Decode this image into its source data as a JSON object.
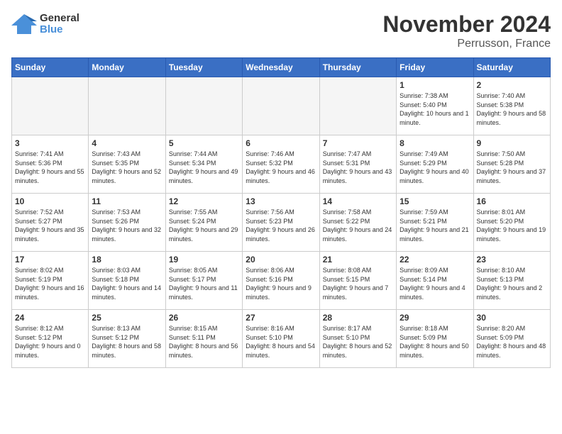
{
  "logo": {
    "general": "General",
    "blue": "Blue"
  },
  "title": "November 2024",
  "location": "Perrusson, France",
  "headers": [
    "Sunday",
    "Monday",
    "Tuesday",
    "Wednesday",
    "Thursday",
    "Friday",
    "Saturday"
  ],
  "weeks": [
    [
      {
        "day": "",
        "detail": ""
      },
      {
        "day": "",
        "detail": ""
      },
      {
        "day": "",
        "detail": ""
      },
      {
        "day": "",
        "detail": ""
      },
      {
        "day": "",
        "detail": ""
      },
      {
        "day": "1",
        "detail": "Sunrise: 7:38 AM\nSunset: 5:40 PM\nDaylight: 10 hours and 1 minute."
      },
      {
        "day": "2",
        "detail": "Sunrise: 7:40 AM\nSunset: 5:38 PM\nDaylight: 9 hours and 58 minutes."
      }
    ],
    [
      {
        "day": "3",
        "detail": "Sunrise: 7:41 AM\nSunset: 5:36 PM\nDaylight: 9 hours and 55 minutes."
      },
      {
        "day": "4",
        "detail": "Sunrise: 7:43 AM\nSunset: 5:35 PM\nDaylight: 9 hours and 52 minutes."
      },
      {
        "day": "5",
        "detail": "Sunrise: 7:44 AM\nSunset: 5:34 PM\nDaylight: 9 hours and 49 minutes."
      },
      {
        "day": "6",
        "detail": "Sunrise: 7:46 AM\nSunset: 5:32 PM\nDaylight: 9 hours and 46 minutes."
      },
      {
        "day": "7",
        "detail": "Sunrise: 7:47 AM\nSunset: 5:31 PM\nDaylight: 9 hours and 43 minutes."
      },
      {
        "day": "8",
        "detail": "Sunrise: 7:49 AM\nSunset: 5:29 PM\nDaylight: 9 hours and 40 minutes."
      },
      {
        "day": "9",
        "detail": "Sunrise: 7:50 AM\nSunset: 5:28 PM\nDaylight: 9 hours and 37 minutes."
      }
    ],
    [
      {
        "day": "10",
        "detail": "Sunrise: 7:52 AM\nSunset: 5:27 PM\nDaylight: 9 hours and 35 minutes."
      },
      {
        "day": "11",
        "detail": "Sunrise: 7:53 AM\nSunset: 5:26 PM\nDaylight: 9 hours and 32 minutes."
      },
      {
        "day": "12",
        "detail": "Sunrise: 7:55 AM\nSunset: 5:24 PM\nDaylight: 9 hours and 29 minutes."
      },
      {
        "day": "13",
        "detail": "Sunrise: 7:56 AM\nSunset: 5:23 PM\nDaylight: 9 hours and 26 minutes."
      },
      {
        "day": "14",
        "detail": "Sunrise: 7:58 AM\nSunset: 5:22 PM\nDaylight: 9 hours and 24 minutes."
      },
      {
        "day": "15",
        "detail": "Sunrise: 7:59 AM\nSunset: 5:21 PM\nDaylight: 9 hours and 21 minutes."
      },
      {
        "day": "16",
        "detail": "Sunrise: 8:01 AM\nSunset: 5:20 PM\nDaylight: 9 hours and 19 minutes."
      }
    ],
    [
      {
        "day": "17",
        "detail": "Sunrise: 8:02 AM\nSunset: 5:19 PM\nDaylight: 9 hours and 16 minutes."
      },
      {
        "day": "18",
        "detail": "Sunrise: 8:03 AM\nSunset: 5:18 PM\nDaylight: 9 hours and 14 minutes."
      },
      {
        "day": "19",
        "detail": "Sunrise: 8:05 AM\nSunset: 5:17 PM\nDaylight: 9 hours and 11 minutes."
      },
      {
        "day": "20",
        "detail": "Sunrise: 8:06 AM\nSunset: 5:16 PM\nDaylight: 9 hours and 9 minutes."
      },
      {
        "day": "21",
        "detail": "Sunrise: 8:08 AM\nSunset: 5:15 PM\nDaylight: 9 hours and 7 minutes."
      },
      {
        "day": "22",
        "detail": "Sunrise: 8:09 AM\nSunset: 5:14 PM\nDaylight: 9 hours and 4 minutes."
      },
      {
        "day": "23",
        "detail": "Sunrise: 8:10 AM\nSunset: 5:13 PM\nDaylight: 9 hours and 2 minutes."
      }
    ],
    [
      {
        "day": "24",
        "detail": "Sunrise: 8:12 AM\nSunset: 5:12 PM\nDaylight: 9 hours and 0 minutes."
      },
      {
        "day": "25",
        "detail": "Sunrise: 8:13 AM\nSunset: 5:12 PM\nDaylight: 8 hours and 58 minutes."
      },
      {
        "day": "26",
        "detail": "Sunrise: 8:15 AM\nSunset: 5:11 PM\nDaylight: 8 hours and 56 minutes."
      },
      {
        "day": "27",
        "detail": "Sunrise: 8:16 AM\nSunset: 5:10 PM\nDaylight: 8 hours and 54 minutes."
      },
      {
        "day": "28",
        "detail": "Sunrise: 8:17 AM\nSunset: 5:10 PM\nDaylight: 8 hours and 52 minutes."
      },
      {
        "day": "29",
        "detail": "Sunrise: 8:18 AM\nSunset: 5:09 PM\nDaylight: 8 hours and 50 minutes."
      },
      {
        "day": "30",
        "detail": "Sunrise: 8:20 AM\nSunset: 5:09 PM\nDaylight: 8 hours and 48 minutes."
      }
    ]
  ]
}
